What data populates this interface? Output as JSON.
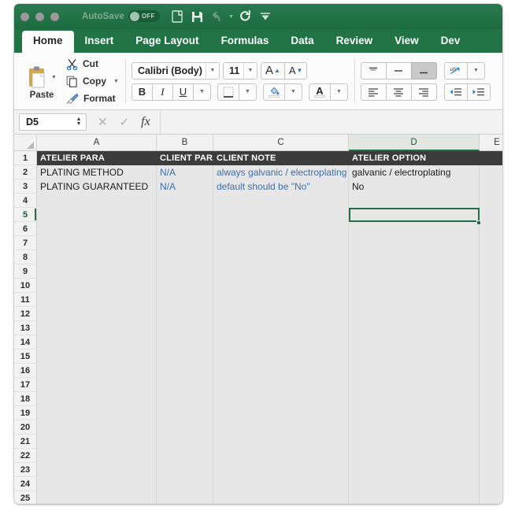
{
  "titlebar": {
    "autosave_label": "AutoSave",
    "autosave_state": "OFF",
    "icons": [
      "new-document-icon",
      "save-icon",
      "undo-icon",
      "redo-icon",
      "customize-toolbar-icon"
    ]
  },
  "ribbon": {
    "tabs": [
      {
        "label": "Home",
        "active": true
      },
      {
        "label": "Insert",
        "active": false
      },
      {
        "label": "Page Layout",
        "active": false
      },
      {
        "label": "Formulas",
        "active": false
      },
      {
        "label": "Data",
        "active": false
      },
      {
        "label": "Review",
        "active": false
      },
      {
        "label": "View",
        "active": false
      },
      {
        "label": "Dev",
        "active": false
      }
    ],
    "clipboard": {
      "paste_label": "Paste",
      "cut_label": "Cut",
      "copy_label": "Copy",
      "format_label": "Format"
    },
    "font": {
      "family_value": "Calibri (Body)",
      "size_value": "11",
      "bold_label": "B",
      "italic_label": "I",
      "underline_label": "U",
      "grow_font_label": "A",
      "shrink_font_label": "A"
    }
  },
  "formula_bar": {
    "name_box_value": "D5",
    "formula_value": "",
    "cancel_label": "✕",
    "confirm_label": "✓",
    "function_label": "fx"
  },
  "sheet": {
    "columns": [
      {
        "label": "A",
        "width": 152,
        "active": false
      },
      {
        "label": "B",
        "width": 72,
        "active": false
      },
      {
        "label": "C",
        "width": 172,
        "active": false
      },
      {
        "label": "D",
        "width": 166,
        "active": true
      },
      {
        "label": "E",
        "width": 45,
        "active": false
      }
    ],
    "rows": [
      "1",
      "2",
      "3",
      "4",
      "5",
      "6",
      "7",
      "8",
      "9",
      "10",
      "11",
      "12",
      "13",
      "14",
      "15",
      "16",
      "17",
      "18",
      "19",
      "20",
      "21",
      "22",
      "23",
      "24",
      "25"
    ],
    "active_row": "5",
    "selected_cell": "D5",
    "data": [
      {
        "row": "1",
        "style": "header",
        "cells": [
          {
            "col": "A",
            "value": "ATELIER PARA",
            "color": "white"
          },
          {
            "col": "B",
            "value": "CLIENT PARA",
            "color": "white"
          },
          {
            "col": "C",
            "value": "CLIENT NOTE",
            "color": "white"
          },
          {
            "col": "D",
            "value": "ATELIER OPTION",
            "color": "white"
          }
        ]
      },
      {
        "row": "2",
        "style": "normal",
        "cells": [
          {
            "col": "A",
            "value": "PLATING METHOD",
            "color": "black"
          },
          {
            "col": "B",
            "value": "N/A",
            "color": "blue"
          },
          {
            "col": "C",
            "value": "always galvanic / electroplating",
            "color": "blue"
          },
          {
            "col": "D",
            "value": "galvanic / electroplating",
            "color": "black"
          }
        ]
      },
      {
        "row": "3",
        "style": "normal",
        "cells": [
          {
            "col": "A",
            "value": "PLATING GUARANTEED",
            "color": "black"
          },
          {
            "col": "B",
            "value": "N/A",
            "color": "blue"
          },
          {
            "col": "C",
            "value": "default should be \"No\"",
            "color": "blue"
          },
          {
            "col": "D",
            "value": "No",
            "color": "black"
          }
        ]
      }
    ]
  },
  "colors": {
    "excel_green": "#217346",
    "header_row_bg": "#3c3c3c",
    "note_blue": "#3d6ea8",
    "selection_green": "#1f7045",
    "grid_bg": "#e7e7e7"
  }
}
